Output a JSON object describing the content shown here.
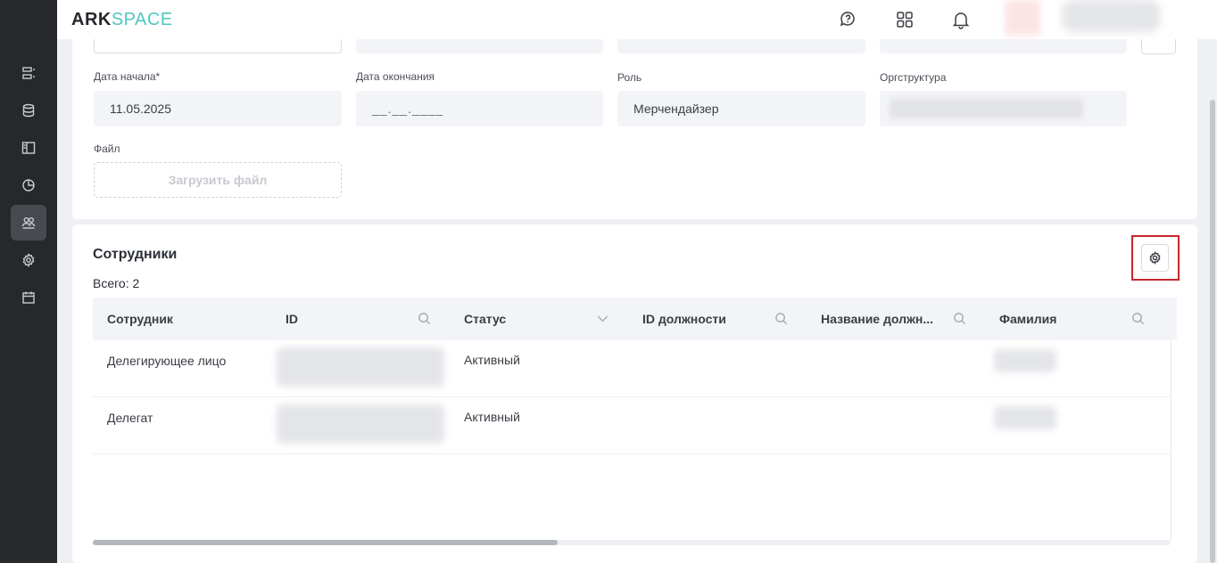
{
  "header": {
    "logo_ark": "ARK",
    "logo_space": "SPACE"
  },
  "form": {
    "start_date": {
      "label": "Дата начала*",
      "value": "11.05.2025"
    },
    "end_date": {
      "label": "Дата окончания",
      "placeholder": "__.__.____"
    },
    "role": {
      "label": "Роль",
      "value": "Мерчендайзер"
    },
    "org": {
      "label": "Оргструктура"
    },
    "file": {
      "label": "Файл",
      "upload_label": "Загрузить файл"
    }
  },
  "employees": {
    "title": "Сотрудники",
    "total": "Всего: 2",
    "columns": [
      {
        "label": "Сотрудник",
        "icon": "none"
      },
      {
        "label": "ID",
        "icon": "search-icon"
      },
      {
        "label": "Статус",
        "icon": "chevron-down-icon"
      },
      {
        "label": "ID должности",
        "icon": "search-icon"
      },
      {
        "label": "Название должн...",
        "icon": "search-icon"
      },
      {
        "label": "Фамилия",
        "icon": "search-icon"
      }
    ],
    "rows": [
      {
        "employee": "Делегирующее лицо",
        "status": "Активный"
      },
      {
        "employee": "Делегат",
        "status": "Активный"
      }
    ]
  },
  "colors": {
    "sidebar_bg": "#26282c",
    "sidebar_active": "#474a50",
    "brand_accent": "#4fc6c2",
    "highlight": "#c8252c"
  }
}
